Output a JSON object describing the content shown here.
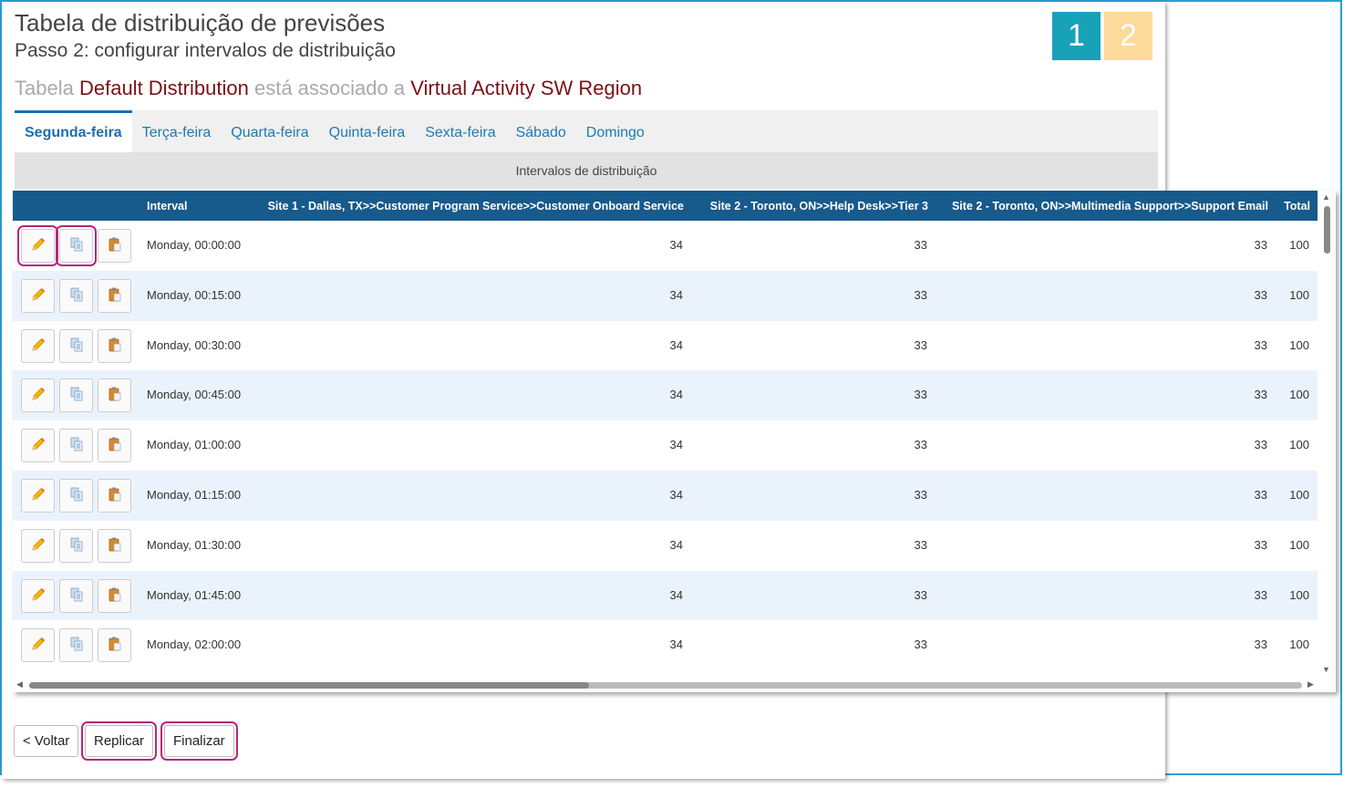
{
  "header": {
    "title": "Tabela de distribuição de previsões",
    "subtitle": "Passo 2: configurar intervalos de distribuição",
    "assoc_prefix": "Tabela",
    "table_name": "Default Distribution",
    "assoc_middle": "está associado a",
    "activity_name": "Virtual Activity SW Region"
  },
  "steps": [
    "1",
    "2"
  ],
  "tabs": [
    "Segunda-feira",
    "Terça-feira",
    "Quarta-feira",
    "Quinta-feira",
    "Sexta-feira",
    "Sábado",
    "Domingo"
  ],
  "active_tab": "Segunda-feira",
  "section_title": "Intervalos de distribuição",
  "grid": {
    "columns": [
      "Interval",
      "Site 1 - Dallas, TX>>Customer Program Service>>Customer Onboard Service",
      "Site 2 - Toronto, ON>>Help Desk>>Tier 3",
      "Site 2 - Toronto, ON>>Multimedia Support>>Support Email",
      "Total"
    ],
    "rows": [
      {
        "interval": "Monday, 00:00:00",
        "c1": "34",
        "c2": "33",
        "c3": "33",
        "total": "100"
      },
      {
        "interval": "Monday, 00:15:00",
        "c1": "34",
        "c2": "33",
        "c3": "33",
        "total": "100"
      },
      {
        "interval": "Monday, 00:30:00",
        "c1": "34",
        "c2": "33",
        "c3": "33",
        "total": "100"
      },
      {
        "interval": "Monday, 00:45:00",
        "c1": "34",
        "c2": "33",
        "c3": "33",
        "total": "100"
      },
      {
        "interval": "Monday, 01:00:00",
        "c1": "34",
        "c2": "33",
        "c3": "33",
        "total": "100"
      },
      {
        "interval": "Monday, 01:15:00",
        "c1": "34",
        "c2": "33",
        "c3": "33",
        "total": "100"
      },
      {
        "interval": "Monday, 01:30:00",
        "c1": "34",
        "c2": "33",
        "c3": "33",
        "total": "100"
      },
      {
        "interval": "Monday, 01:45:00",
        "c1": "34",
        "c2": "33",
        "c3": "33",
        "total": "100"
      },
      {
        "interval": "Monday, 02:00:00",
        "c1": "34",
        "c2": "33",
        "c3": "33",
        "total": "100"
      }
    ],
    "row_actions": [
      "edit-icon",
      "copy-icon",
      "paste-icon"
    ]
  },
  "footer": {
    "back_label": "< Voltar",
    "replicate_label": "Replicar",
    "finish_label": "Finalizar"
  },
  "colors": {
    "frame_border": "#2a9fd6",
    "header_bg": "#175a8c",
    "tab_active": "#1d6fb0",
    "highlight_text": "#7a1017",
    "step1": "#17a2b8",
    "step2": "#fdd99a",
    "annotation": "#b5267a"
  }
}
